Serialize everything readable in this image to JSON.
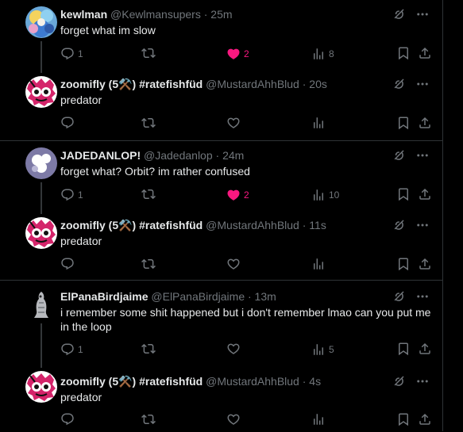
{
  "colors": {
    "background": "#000000",
    "text": "#e7e9ea",
    "muted": "#71767b",
    "divider": "#2f3336",
    "like": "#f91880"
  },
  "icons": {
    "more": "ellipsis-icon",
    "grok": "grok-icon",
    "reply": "reply-icon",
    "repost": "repost-icon",
    "like": "heart-icon",
    "views": "views-icon",
    "bookmark": "bookmark-icon",
    "share": "share-icon"
  },
  "threads": [
    {
      "parent": {
        "name": "kewlman",
        "handle": "@Kewlmansupers",
        "time": "· 25m",
        "text": "forget what im slow",
        "replies": "1",
        "reposts": "",
        "likes": "2",
        "liked": true,
        "views": "8"
      },
      "reply": {
        "name": "zoomifly (5⚒️) #ratefishfüd",
        "handle": "@MustardAhhBlud",
        "time": "· 20s",
        "text": "predator",
        "replies": "",
        "reposts": "",
        "likes": "",
        "liked": false,
        "views": ""
      }
    },
    {
      "parent": {
        "name": "JADEDANLOP!",
        "handle": "@Jadedanlop",
        "time": "· 24m",
        "text": "forget what? Orbit? im rather confused",
        "replies": "1",
        "reposts": "",
        "likes": "2",
        "liked": true,
        "views": "10"
      },
      "reply": {
        "name": "zoomifly (5⚒️) #ratefishfüd",
        "handle": "@MustardAhhBlud",
        "time": "· 11s",
        "text": "predator",
        "replies": "",
        "reposts": "",
        "likes": "",
        "liked": false,
        "views": ""
      }
    },
    {
      "parent": {
        "name": "ElPanaBirdjaime",
        "handle": "@ElPanaBirdjaime",
        "time": "· 13m",
        "text": "i remember some shit happened but i don't remember lmao can you put me in the loop",
        "replies": "1",
        "reposts": "",
        "likes": "",
        "liked": false,
        "views": "5"
      },
      "reply": {
        "name": "zoomifly (5⚒️) #ratefishfüd",
        "handle": "@MustardAhhBlud",
        "time": "· 4s",
        "text": "predator",
        "replies": "",
        "reposts": "",
        "likes": "",
        "liked": false,
        "views": ""
      }
    }
  ]
}
